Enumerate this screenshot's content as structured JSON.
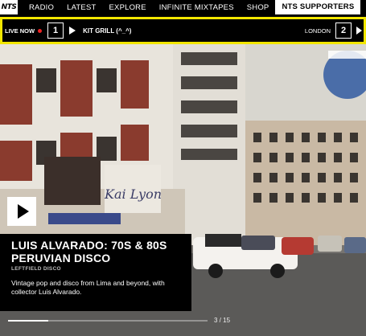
{
  "nav": {
    "logo_text": "NTS",
    "links": [
      "RADIO",
      "LATEST",
      "EXPLORE",
      "INFINITE MIXTAPES",
      "SHOP",
      "NTS SUPPORTERS"
    ],
    "active_link": "NTS SUPPORTERS"
  },
  "live": {
    "label": "LIVE NOW",
    "channel_1": "1",
    "show_name": "KIT GRILL (^_^)",
    "location": "LONDON",
    "channel_2": "2",
    "accent_color": "#f2e600",
    "live_dot_color": "#e22222"
  },
  "feature": {
    "title": "LUIS ALVARADO: 70S & 80S PERUVIAN DISCO",
    "genre": "LEFTFIELD DISCO",
    "description": "Vintage pop and disco from Lima and beyond, with collector Luis Alvarado.",
    "slide_counter": "3 / 15",
    "progress_fraction": 0.2
  }
}
